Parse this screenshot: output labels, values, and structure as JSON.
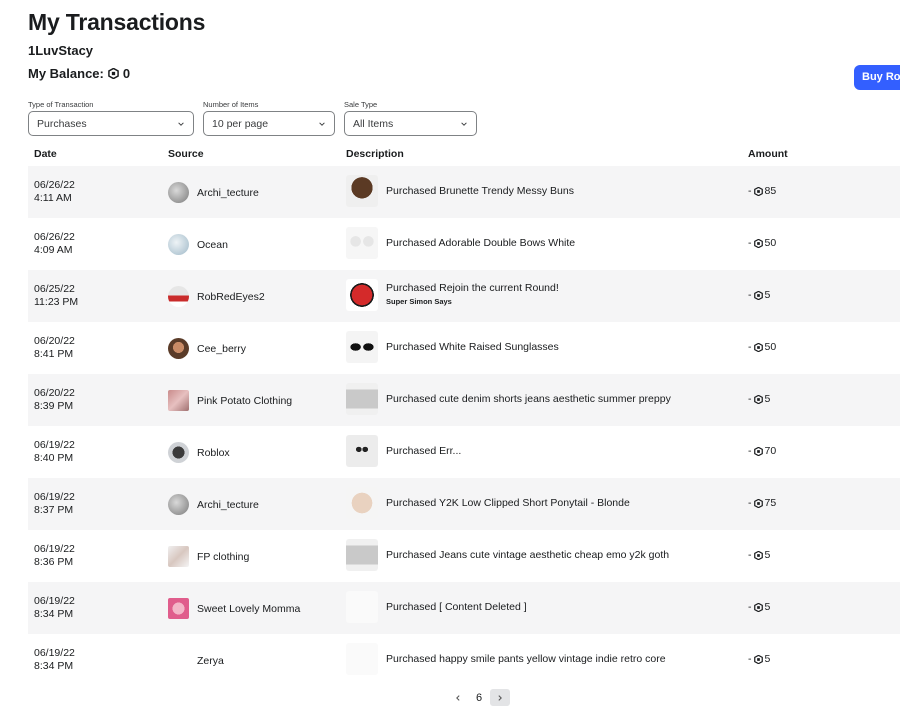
{
  "header": {
    "title": "My Transactions",
    "username": "1LuvStacy",
    "balance_label": "My Balance:",
    "balance_value": "0",
    "buy_button": "Buy Robux"
  },
  "filters": [
    {
      "label": "Type of Transaction",
      "value": "Purchases"
    },
    {
      "label": "Number of Items",
      "value": "10 per page"
    },
    {
      "label": "Sale Type",
      "value": "All Items"
    }
  ],
  "table": {
    "columns": [
      "Date",
      "Source",
      "Description",
      "Amount"
    ],
    "rows": [
      {
        "date": "06/26/22",
        "time": "4:11 AM",
        "source": "Archi_tecture",
        "verb": "Purchased",
        "item": "Brunette Trendy Messy Buns",
        "sub": "",
        "amount": "85"
      },
      {
        "date": "06/26/22",
        "time": "4:09 AM",
        "source": "Ocean",
        "verb": "Purchased",
        "item": "Adorable Double Bows White",
        "sub": "",
        "amount": "50"
      },
      {
        "date": "06/25/22",
        "time": "11:23 PM",
        "source": "RobRedEyes2",
        "verb": "Purchased",
        "item": "Rejoin the current Round!",
        "sub": "Super Simon Says",
        "amount": "5"
      },
      {
        "date": "06/20/22",
        "time": "8:41 PM",
        "source": "Cee_berry",
        "verb": "Purchased",
        "item": "White Raised Sunglasses",
        "sub": "",
        "amount": "50"
      },
      {
        "date": "06/20/22",
        "time": "8:39 PM",
        "source": "Pink Potato Clothing",
        "verb": "Purchased",
        "item": "cute denim shorts jeans aesthetic summer preppy",
        "sub": "",
        "amount": "5"
      },
      {
        "date": "06/19/22",
        "time": "8:40 PM",
        "source": "Roblox",
        "verb": "Purchased",
        "item": "Err...",
        "sub": "",
        "amount": "70"
      },
      {
        "date": "06/19/22",
        "time": "8:37 PM",
        "source": "Archi_tecture",
        "verb": "Purchased",
        "item": "Y2K Low Clipped Short Ponytail - Blonde",
        "sub": "",
        "amount": "75"
      },
      {
        "date": "06/19/22",
        "time": "8:36 PM",
        "source": "FP clothing",
        "verb": "Purchased",
        "item": "Jeans cute vintage aesthetic cheap emo y2k goth",
        "sub": "",
        "amount": "5"
      },
      {
        "date": "06/19/22",
        "time": "8:34 PM",
        "source": "Sweet Lovely Momma",
        "verb": "Purchased",
        "item": "[ Content Deleted ]",
        "sub": "",
        "amount": "5"
      },
      {
        "date": "06/19/22",
        "time": "8:34 PM",
        "source": "Zerya",
        "verb": "Purchased",
        "item": "happy smile pants yellow vintage indie retro core",
        "sub": "",
        "amount": "5"
      }
    ]
  },
  "pagination": {
    "page": "6"
  },
  "colors": {
    "accent": "#335fff",
    "row_alt": "#f5f5f6",
    "text": "#1a1c1e"
  },
  "icons": {
    "currency": "robux-icon",
    "prev": "chevron-left-icon",
    "next": "chevron-right-icon",
    "dropdown": "chevron-down-icon"
  }
}
